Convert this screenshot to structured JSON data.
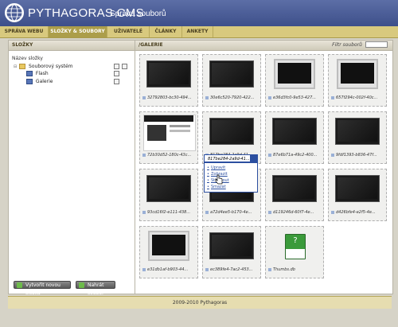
{
  "app": {
    "title": "PYTHAGORAS CMS",
    "subtitle": "Správa souborů"
  },
  "tabs": [
    {
      "label": "SPRÁVA WEBU",
      "active": false
    },
    {
      "label": "SLOŽKY & SOUBORY",
      "active": true
    },
    {
      "label": "UŽIVATELÉ",
      "active": false
    },
    {
      "label": "ČLÁNKY",
      "active": false
    },
    {
      "label": "ANKETY",
      "active": false
    }
  ],
  "left_panel": {
    "header": "SLOŽKY",
    "column_header": "Název složky",
    "tree": [
      {
        "label": "Souborový systém",
        "level": 0,
        "icon": "folder-icon"
      },
      {
        "label": "Flash",
        "level": 1,
        "icon": "subfolder-icon"
      },
      {
        "label": "Galerie",
        "level": 1,
        "icon": "subfolder-icon"
      }
    ],
    "buttons": {
      "new_folder": "Vytvořit novou složku",
      "upload": "Nahrát soubor"
    }
  },
  "right_panel": {
    "header": "/GALERIE",
    "filter_label": "Filtr souborů",
    "filter_value": ""
  },
  "files": [
    {
      "name": "32792803-bc30-494...",
      "thumb": "black-tv"
    },
    {
      "name": "30e6c520-7920-422...",
      "thumb": "black-tv"
    },
    {
      "name": "e36d3fc0-9e53-427...",
      "thumb": "silver-tv"
    },
    {
      "name": "657f294c-002f-40c...",
      "thumb": "silver-tv"
    },
    {
      "name": "72b30d52-180c-43c...",
      "thumb": "webpage"
    },
    {
      "name": "817be284-2a9d-41...",
      "thumb": "black-tv"
    },
    {
      "name": "87e6b71a-49c2-400...",
      "thumb": "black-tv"
    },
    {
      "name": "9fdf1393-b836-47f...",
      "thumb": "black-tv"
    },
    {
      "name": "93cd16f2-e111-438...",
      "thumb": "black-tv"
    },
    {
      "name": "a72d4ee5-b170-4e...",
      "thumb": "black-tv"
    },
    {
      "name": "d119246d-60f7-4e...",
      "thumb": "black-tv"
    },
    {
      "name": "d426bfe4-e2f5-4e...",
      "thumb": "black-tv"
    },
    {
      "name": "e31db1af-b903-44...",
      "thumb": "silver-tv"
    },
    {
      "name": "ec389fe4-7ac2-453...",
      "thumb": "black-tv"
    },
    {
      "name": "Thumbs.db",
      "thumb": "unknown-file"
    }
  ],
  "dropdown": {
    "selected": "817be284-2a9d-41...",
    "items": [
      "Upravit",
      "Zobrazit",
      "Stáhnout",
      "Smazat"
    ]
  },
  "footer": "2009-2010 Pythagoras"
}
